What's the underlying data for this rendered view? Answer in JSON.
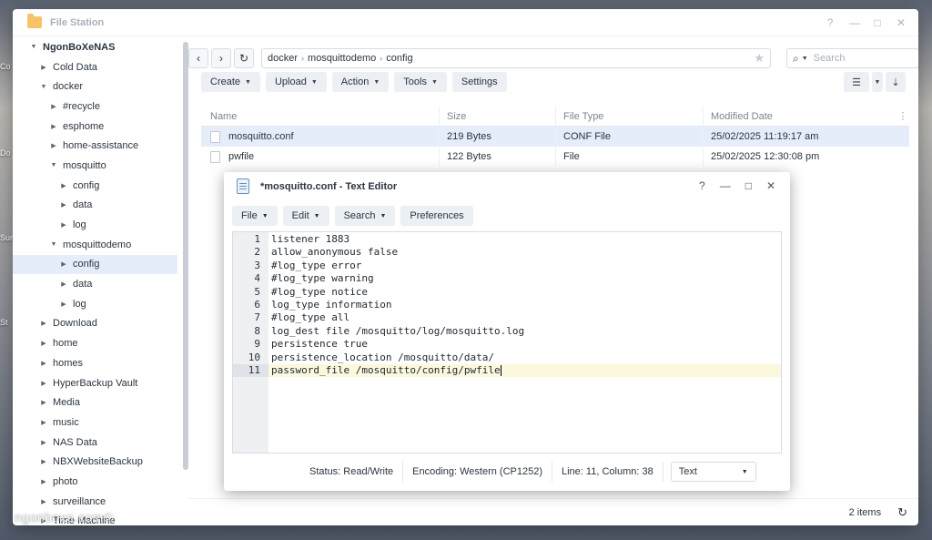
{
  "desktop": {
    "labels": [
      "Co",
      "Do",
      "Sur",
      "St"
    ],
    "watermark": "ngonboxe.com©"
  },
  "file_station": {
    "title": "File Station",
    "controls": [
      "?",
      "—",
      "□",
      "✕"
    ],
    "tree": [
      {
        "label": "NgonBoXeNAS",
        "level": 0,
        "expanded": true
      },
      {
        "label": "Cold Data",
        "level": 1,
        "expanded": false
      },
      {
        "label": "docker",
        "level": 1,
        "expanded": true
      },
      {
        "label": "#recycle",
        "level": 2,
        "expanded": false
      },
      {
        "label": "esphome",
        "level": 2,
        "expanded": false
      },
      {
        "label": "home-assistance",
        "level": 2,
        "expanded": false
      },
      {
        "label": "mosquitto",
        "level": 2,
        "expanded": true
      },
      {
        "label": "config",
        "level": 3,
        "expanded": false
      },
      {
        "label": "data",
        "level": 3,
        "expanded": false
      },
      {
        "label": "log",
        "level": 3,
        "expanded": false
      },
      {
        "label": "mosquittodemo",
        "level": 2,
        "expanded": true
      },
      {
        "label": "config",
        "level": 3,
        "expanded": false,
        "selected": true
      },
      {
        "label": "data",
        "level": 3,
        "expanded": false
      },
      {
        "label": "log",
        "level": 3,
        "expanded": false
      },
      {
        "label": "Download",
        "level": 1,
        "expanded": false
      },
      {
        "label": "home",
        "level": 1,
        "expanded": false
      },
      {
        "label": "homes",
        "level": 1,
        "expanded": false
      },
      {
        "label": "HyperBackup Vault",
        "level": 1,
        "expanded": false
      },
      {
        "label": "Media",
        "level": 1,
        "expanded": false
      },
      {
        "label": "music",
        "level": 1,
        "expanded": false
      },
      {
        "label": "NAS Data",
        "level": 1,
        "expanded": false
      },
      {
        "label": "NBXWebsiteBackup",
        "level": 1,
        "expanded": false
      },
      {
        "label": "photo",
        "level": 1,
        "expanded": false
      },
      {
        "label": "surveillance",
        "level": 1,
        "expanded": false
      },
      {
        "label": "Time Machine",
        "level": 1,
        "expanded": false
      }
    ],
    "path": [
      "docker",
      "mosquittodemo",
      "config"
    ],
    "search_placeholder": "Search",
    "toolbar": {
      "create": "Create",
      "upload": "Upload",
      "action": "Action",
      "tools": "Tools",
      "settings": "Settings"
    },
    "columns": {
      "name": "Name",
      "size": "Size",
      "type": "File Type",
      "modified": "Modified Date"
    },
    "files": [
      {
        "name": "mosquitto.conf",
        "size": "219 Bytes",
        "type": "CONF File",
        "modified": "25/02/2025 11:19:17 am",
        "selected": true
      },
      {
        "name": "pwfile",
        "size": "122 Bytes",
        "type": "File",
        "modified": "25/02/2025 12:30:08 pm",
        "selected": false
      }
    ],
    "item_count": "2 items"
  },
  "text_editor": {
    "title": "*mosquitto.conf - Text Editor",
    "controls": [
      "?",
      "—",
      "□",
      "✕"
    ],
    "menu": {
      "file": "File",
      "edit": "Edit",
      "search": "Search",
      "preferences": "Preferences"
    },
    "lines": [
      "listener 1883",
      "allow_anonymous false",
      "#log_type error",
      "#log_type warning",
      "#log_type notice",
      "log_type information",
      "#log_type all",
      "log_dest file /mosquitto/log/mosquitto.log",
      "persistence true",
      "persistence_location /mosquitto/data/",
      "password_file /mosquitto/config/pwfile"
    ],
    "active_line": 11,
    "status": {
      "mode": "Status: Read/Write",
      "encoding": "Encoding: Western (CP1252)",
      "position": "Line: 11, Column: 38",
      "syntax": "Text"
    }
  }
}
